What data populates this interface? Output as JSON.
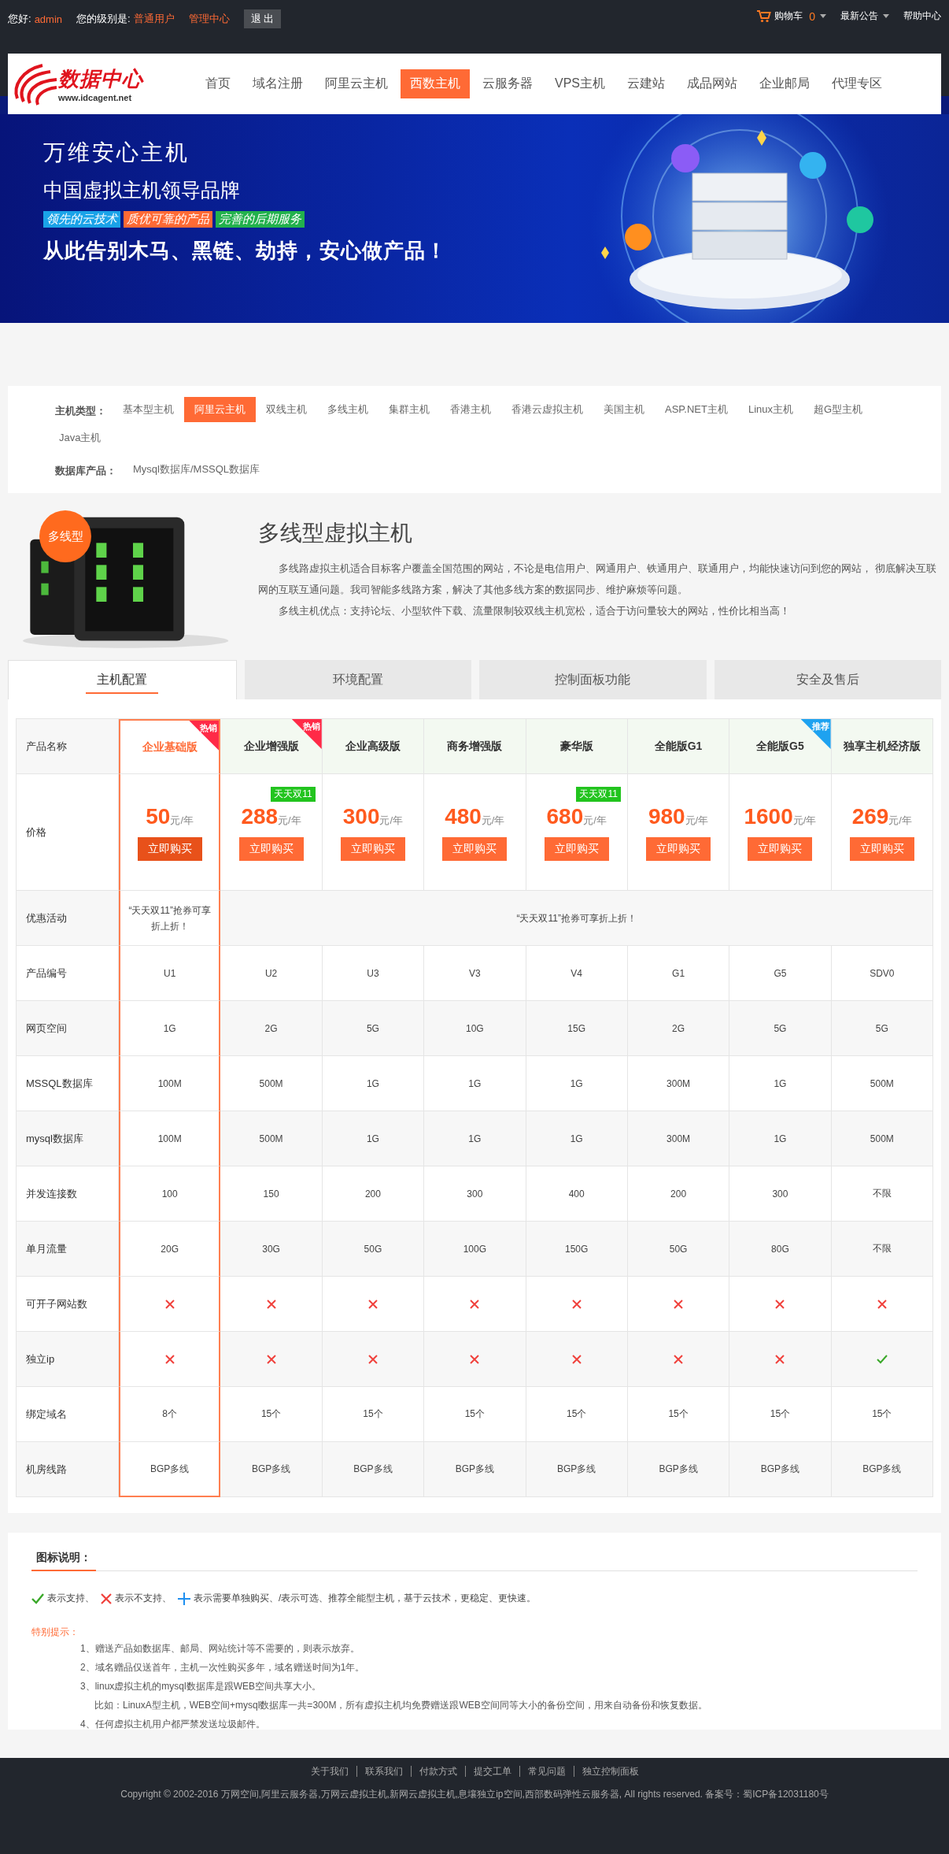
{
  "top_bar": {
    "greeting_label": "您好:",
    "username": "admin",
    "level_label": "您的级别是:",
    "level": "普通用户",
    "admin_link": "管理中心",
    "logout": "退 出",
    "cart": "购物车",
    "cart_count": "0",
    "notice": "最新公告",
    "help": "帮助中心"
  },
  "nav": {
    "logo": {
      "name": "数据中心",
      "url": "www.idcagent.net"
    },
    "items": [
      {
        "label": "首页",
        "selected": false
      },
      {
        "label": "域名注册",
        "selected": false
      },
      {
        "label": "阿里云主机",
        "selected": false
      },
      {
        "label": "西数主机",
        "selected": true
      },
      {
        "label": "云服务器",
        "selected": false
      },
      {
        "label": "VPS主机",
        "selected": false
      },
      {
        "label": "云建站",
        "selected": false
      },
      {
        "label": "成品网站",
        "selected": false
      },
      {
        "label": "企业邮局",
        "selected": false
      },
      {
        "label": "代理专区",
        "selected": false
      }
    ]
  },
  "banner": {
    "title": "万维安心主机",
    "subtitle": "中国虚拟主机领导品牌",
    "tags": [
      {
        "label": "领先的云技术",
        "color": "#1aa3e8"
      },
      {
        "label": "质优可靠的产品",
        "color": "#ff6a35"
      },
      {
        "label": "完善的后期服务",
        "color": "#22b14c"
      }
    ],
    "slogan": "从此告别木马、黑链、劫持，安心做产品！"
  },
  "filters": [
    {
      "label": "主机类型：",
      "options": [
        {
          "label": "基本型主机",
          "selected": false
        },
        {
          "label": "阿里云主机",
          "selected": true
        },
        {
          "label": "双线主机",
          "selected": false
        },
        {
          "label": "多线主机",
          "selected": false
        },
        {
          "label": "集群主机",
          "selected": false
        },
        {
          "label": "香港主机",
          "selected": false
        },
        {
          "label": "香港云虚拟主机",
          "selected": false
        },
        {
          "label": "美国主机",
          "selected": false
        },
        {
          "label": "ASP.NET主机",
          "selected": false
        },
        {
          "label": "Linux主机",
          "selected": false
        },
        {
          "label": "超G型主机",
          "selected": false
        },
        {
          "label": "Java主机",
          "selected": false
        }
      ]
    },
    {
      "label": "数据库产品：",
      "options": [
        {
          "label": "Mysql数据库/MSSQL数据库",
          "selected": false
        }
      ]
    }
  ],
  "product": {
    "badge": "多线型",
    "title": "多线型虚拟主机",
    "paragraphs": [
      "多线路虚拟主机适合目标客户覆盖全国范围的网站，不论是电信用户、网通用户、铁通用户、联通用户，均能快速访问到您的网站， 彻底解决互联网的互联互通问题。我司智能多线路方案，解决了其他多线方案的数据同步、维护麻烦等问题。",
      "多线主机优点：支持论坛、小型软件下载、流量限制较双线主机宽松，适合于访问量较大的网站，性价比相当高！"
    ]
  },
  "tabs": [
    {
      "label": "主机配置",
      "selected": true
    },
    {
      "label": "环境配置",
      "selected": false
    },
    {
      "label": "控制面板功能",
      "selected": false
    },
    {
      "label": "安全及售后",
      "selected": false
    }
  ],
  "table": {
    "corner": "产品名称",
    "columns": [
      {
        "name": "企业基础版",
        "highlighted": true,
        "ribbon": {
          "text": "热销",
          "color": "#ff2a47"
        }
      },
      {
        "name": "企业增强版",
        "highlighted": false,
        "ribbon": {
          "text": "热销",
          "color": "#ff2a47"
        }
      },
      {
        "name": "企业高级版",
        "highlighted": false
      },
      {
        "name": "商务增强版",
        "highlighted": false
      },
      {
        "name": "豪华版",
        "highlighted": false
      },
      {
        "name": "全能版G1",
        "highlighted": false
      },
      {
        "name": "全能版G5",
        "highlighted": false,
        "ribbon": {
          "text": "推荐",
          "color": "#1ea2f0"
        }
      },
      {
        "name": "独享主机经济版",
        "highlighted": false
      }
    ],
    "price_row": {
      "label": "价格",
      "cells": [
        {
          "price": "50",
          "unit": "元/年",
          "button": "立即购买"
        },
        {
          "price": "288",
          "unit": "元/年",
          "tag": "天天双11",
          "button": "立即购买"
        },
        {
          "price": "300",
          "unit": "元/年",
          "button": "立即购买"
        },
        {
          "price": "480",
          "unit": "元/年",
          "button": "立即购买"
        },
        {
          "price": "680",
          "unit": "元/年",
          "tag": "天天双11",
          "button": "立即购买"
        },
        {
          "price": "980",
          "unit": "元/年",
          "button": "立即购买"
        },
        {
          "price": "1600",
          "unit": "元/年",
          "button": "立即购买"
        },
        {
          "price": "269",
          "unit": "元/年",
          "button": "立即购买"
        }
      ]
    },
    "promo_row": {
      "label": "优惠活动",
      "featured_text": "“天天双11”抢券可享折上折！",
      "shared_text": "“天天双11”抢券可享折上折！"
    },
    "rows": [
      {
        "label": "产品编号",
        "kind": "text",
        "cells": [
          "U1",
          "U2",
          "U3",
          "V3",
          "V4",
          "G1",
          "G5",
          "SDV0"
        ]
      },
      {
        "label": "网页空间",
        "kind": "text",
        "cells": [
          "1G",
          "2G",
          "5G",
          "10G",
          "15G",
          "2G",
          "5G",
          "5G"
        ]
      },
      {
        "label": "MSSQL数据库",
        "kind": "text",
        "cells": [
          "100M",
          "500M",
          "1G",
          "1G",
          "1G",
          "300M",
          "1G",
          "500M"
        ]
      },
      {
        "label": "mysql数据库",
        "kind": "text",
        "cells": [
          "100M",
          "500M",
          "1G",
          "1G",
          "1G",
          "300M",
          "1G",
          "500M"
        ]
      },
      {
        "label": "并发连接数",
        "kind": "text",
        "cells": [
          "100",
          "150",
          "200",
          "300",
          "400",
          "200",
          "300",
          "不限"
        ]
      },
      {
        "label": "单月流量",
        "kind": "text",
        "cells": [
          "20G",
          "30G",
          "50G",
          "100G",
          "150G",
          "50G",
          "80G",
          "不限"
        ]
      },
      {
        "label": "可开子网站数",
        "kind": "support",
        "cells": [
          {
            "supported": false
          },
          {
            "supported": false
          },
          {
            "supported": false
          },
          {
            "supported": false
          },
          {
            "supported": false
          },
          {
            "supported": false
          },
          {
            "supported": false
          },
          {
            "supported": false
          }
        ]
      },
      {
        "label": "独立ip",
        "kind": "support",
        "cells": [
          {
            "supported": false
          },
          {
            "supported": false
          },
          {
            "supported": false
          },
          {
            "supported": false
          },
          {
            "supported": false
          },
          {
            "supported": false
          },
          {
            "supported": false
          },
          {
            "supported": true
          }
        ]
      },
      {
        "label": "绑定域名",
        "kind": "text",
        "cells": [
          "8个",
          "15个",
          "15个",
          "15个",
          "15个",
          "15个",
          "15个",
          "15个"
        ]
      },
      {
        "label": "机房线路",
        "kind": "text",
        "cells": [
          "BGP多线",
          "BGP多线",
          "BGP多线",
          "BGP多线",
          "BGP多线",
          "BGP多线",
          "BGP多线",
          "BGP多线"
        ]
      }
    ]
  },
  "legend": {
    "title": "图标说明：",
    "items": [
      {
        "kind": "check",
        "text": "表示支持、"
      },
      {
        "kind": "cross",
        "text": "表示不支持、"
      },
      {
        "kind": "plus",
        "text": "表示需要单独购买、/表示可选、推荐全能型主机，基于云技术，更稳定、更快速。"
      }
    ],
    "notice_title": "特别提示：",
    "notes": [
      {
        "text": "1、赠送产品如数据库、邮局、网站统计等不需要的，则表示放弃。"
      },
      {
        "text": "2、域名赠品仅送首年，主机一次性购买多年，域名赠送时间为1年。"
      },
      {
        "text": "3、linux虚拟主机的mysql数据库是跟WEB空间共享大小。",
        "detail": "比如：LinuxA型主机，WEB空间+mysql数据库一共=300M，所有虚拟主机均免费赠送跟WEB空间同等大小的备份空间，用来自动备份和恢复数据。"
      },
      {
        "text": "4、任何虚拟主机用户都严禁发送垃圾邮件。"
      }
    ]
  },
  "footer": {
    "links": [
      "关于我们",
      "联系我们",
      "付款方式",
      "提交工单",
      "常见问题",
      "独立控制面板"
    ],
    "copyright": "Copyright © 2002-2016 万网空间,阿里云服务器,万网云虚拟主机,新网云虚拟主机,息壤独立ip空间,西部数码弹性云服务器, All rights reserved.   备案号：蜀ICP备12031180号"
  }
}
